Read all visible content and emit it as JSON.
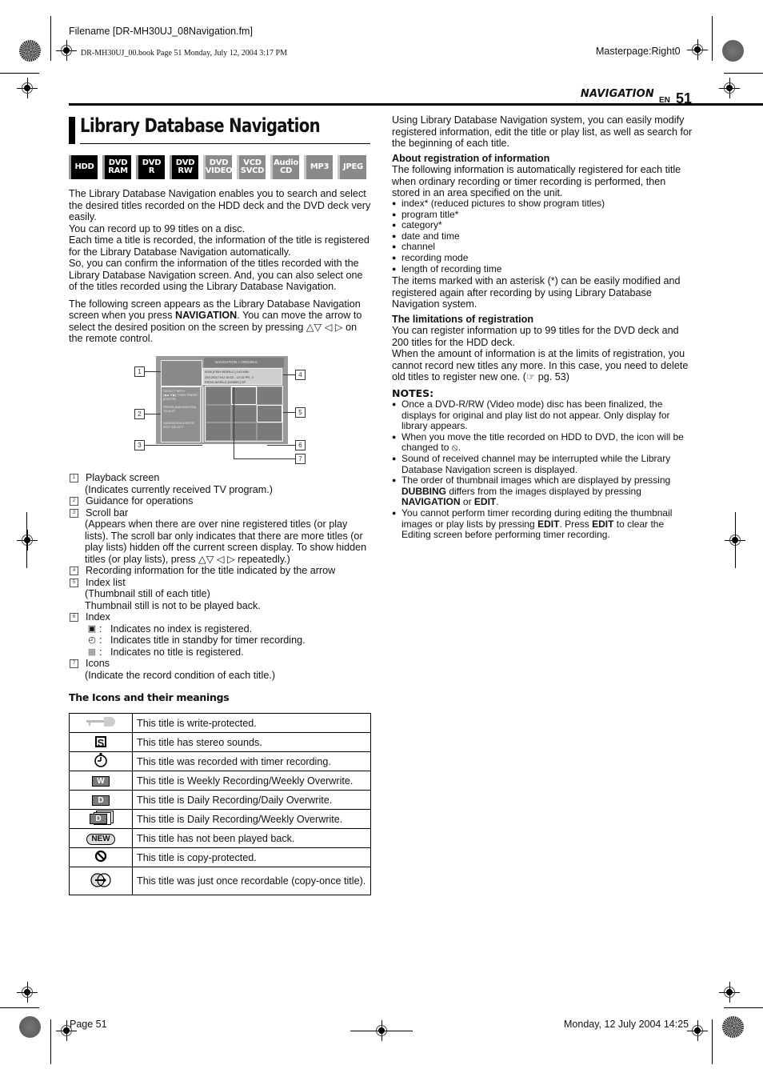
{
  "print_marks": {
    "filename": "Filename [DR-MH30UJ_08Navigation.fm]",
    "book_line": "DR-MH30UJ_00.book  Page 51  Monday, July 12, 2004  3:17 PM",
    "masterpage": "Masterpage:Right0",
    "footer_page": "Page 51",
    "footer_date": "Monday, 12 July 2004  14:25"
  },
  "header": {
    "section": "NAVIGATION",
    "lang": "EN",
    "page_number": "51"
  },
  "title": "Library Database Navigation",
  "badges": [
    {
      "line1": "HDD",
      "line2": "",
      "active": true
    },
    {
      "line1": "DVD",
      "line2": "RAM",
      "active": true
    },
    {
      "line1": "DVD",
      "line2": "R",
      "active": true
    },
    {
      "line1": "DVD",
      "line2": "RW",
      "active": true
    },
    {
      "line1": "DVD",
      "line2": "VIDEO",
      "active": false
    },
    {
      "line1": "VCD",
      "line2": "SVCD",
      "active": false
    },
    {
      "line1": "Audio",
      "line2": "CD",
      "active": false
    },
    {
      "line1": "MP3",
      "line2": "",
      "active": false
    },
    {
      "line1": "JPEG",
      "line2": "",
      "active": false
    }
  ],
  "intro": {
    "p1": "The Library Database Navigation enables you to search and select the desired titles recorded on the HDD deck and the DVD deck very easily.",
    "p2": "You can record up to 99 titles on a disc.",
    "p3": "Each time a title is recorded, the information of the title is registered for the Library Database Navigation automatically.",
    "p4": "So, you can confirm the information of the titles recorded with the Library Database Navigation screen. And, you can also select one of the titles recorded using the Library Database Navigation.",
    "p5_pre": "The following screen appears as the Library Database Navigation screen when you press ",
    "p5_bold": "NAVIGATION",
    "p5_post": ". You can move the arrow to select the desired position on the screen by pressing △▽ ◁ ▷ on the remote control."
  },
  "diagram": {
    "header_text": "NAVIGATION > ORIGINAL",
    "info_line1": "0005  [FISH WORLD          ]     143  MIN",
    "info_line2": "25/12/03 THU  10:00 - 10:15       PR. 3",
    "info_line3": "FROG WORLD                    [HOBBY] SP",
    "guide_1": "SELECT WITH [◀▲▼▶] THEN PRESS [ENTER]",
    "guide_2": "PRESS [NAVIGATION] TO EXIT",
    "guide_3": "NAVIGATION  ENTER  EXIT  SELECT",
    "callouts": [
      "1",
      "2",
      "3",
      "4",
      "5",
      "6",
      "7"
    ]
  },
  "numbered_items": [
    {
      "num": "1",
      "label": "Playback screen",
      "sub": [
        "(Indicates currently received TV program.)"
      ]
    },
    {
      "num": "2",
      "label": "Guidance for operations",
      "sub": []
    },
    {
      "num": "3",
      "label": "Scroll bar",
      "sub": [
        "(Appears when there are over nine registered titles (or play lists). The scroll bar only indicates that there are more titles (or play lists) hidden off the current screen display. To show hidden titles (or play lists), press △▽ ◁ ▷ repeatedly.)"
      ]
    },
    {
      "num": "4",
      "label": "Recording information for the title indicated by the arrow",
      "sub": []
    },
    {
      "num": "5",
      "label": "Index list",
      "sub": [
        "(Thumbnail still of each title)",
        "Thumbnail still is not to be played back."
      ]
    },
    {
      "num": "6",
      "label": "Index",
      "sub": []
    },
    {
      "num": "7",
      "label": "Icons",
      "sub": [
        "(Indicate the record condition of each title.)"
      ]
    }
  ],
  "index_icons": [
    {
      "icon": "no-index-icon",
      "text": "Indicates no index is registered."
    },
    {
      "icon": "timer-standby-icon",
      "text": "Indicates title in standby for timer recording."
    },
    {
      "icon": "no-title-icon",
      "text": "Indicates no title is registered."
    }
  ],
  "icons_table": {
    "heading": "The Icons and their meanings",
    "rows": [
      {
        "icon": "key-icon",
        "glyph": "",
        "text": "This title is write-protected."
      },
      {
        "icon": "stereo-icon",
        "glyph": "S",
        "text": "This title has stereo sounds."
      },
      {
        "icon": "timer-icon",
        "glyph": "◷",
        "text": "This title was recorded with timer recording."
      },
      {
        "icon": "weekly-icon",
        "glyph": "W",
        "text": "This title is Weekly Recording/Weekly Overwrite."
      },
      {
        "icon": "daily-icon",
        "glyph": "D",
        "text": "This title is Daily Recording/Daily Overwrite."
      },
      {
        "icon": "daily-weekly-icon",
        "glyph": "D",
        "text": "This title is Daily Recording/Weekly Overwrite."
      },
      {
        "icon": "new-icon",
        "glyph": "NEW",
        "text": "This title has not been played back."
      },
      {
        "icon": "copy-protected-icon",
        "glyph": "⦸",
        "text": "This title is copy-protected."
      },
      {
        "icon": "copy-once-icon",
        "glyph": "",
        "text": "This title was just once recordable (copy-once title)."
      }
    ]
  },
  "right": {
    "intro": "Using Library Database Navigation system, you can easily modify registered information, edit the title or play list, as well as search for the beginning of each title.",
    "reg_heading": "About registration of information",
    "reg_text": "The following information is automatically registered for each title when ordinary recording or timer recording is performed, then stored in an area specified on the unit.",
    "reg_items": [
      "index* (reduced pictures to show program titles)",
      "program title*",
      "category*",
      "date and time",
      "channel",
      "recording mode",
      "length of recording time"
    ],
    "asterisk_note": "The items marked with an asterisk (*) can be easily modified and registered again after recording by using Library Database Navigation system.",
    "limits_heading": "The limitations of registration",
    "limits_text1": "You can register information up to 99 titles for the DVD deck and 200 titles for the HDD deck.",
    "limits_text2": "When the amount of information is at the limits of registration, you cannot record new titles any more. In this case, you need to delete old titles to register new one. (☞ pg. 53)",
    "notes_heading": "NOTES:",
    "notes": [
      {
        "pre": "Once a DVD-R/RW (Video mode) disc has been finalized, the displays for original and play list do not appear. Only display for library appears.",
        "b1": "",
        "mid": "",
        "b2": "",
        "post": ""
      },
      {
        "pre": "When you move the title recorded on HDD to DVD, the icon will be changed to ⦸.",
        "b1": "",
        "mid": "",
        "b2": "",
        "post": ""
      },
      {
        "pre": "Sound of received channel may be interrupted while the Library Database Navigation screen is displayed.",
        "b1": "",
        "mid": "",
        "b2": "",
        "post": ""
      },
      {
        "pre": "The order of thumbnail images which are displayed by pressing ",
        "b1": "DUBBING",
        "mid": " differs from the images displayed by pressing ",
        "b2": "NAVIGATION",
        "post": " or ",
        "b3": "EDIT",
        "end": "."
      },
      {
        "pre": "You cannot perform timer recording during editing the thumbnail images or play lists by pressing ",
        "b1": "EDIT",
        "mid": ". Press ",
        "b2": "EDIT",
        "post": " to clear the Editing screen before performing timer recording."
      }
    ]
  }
}
